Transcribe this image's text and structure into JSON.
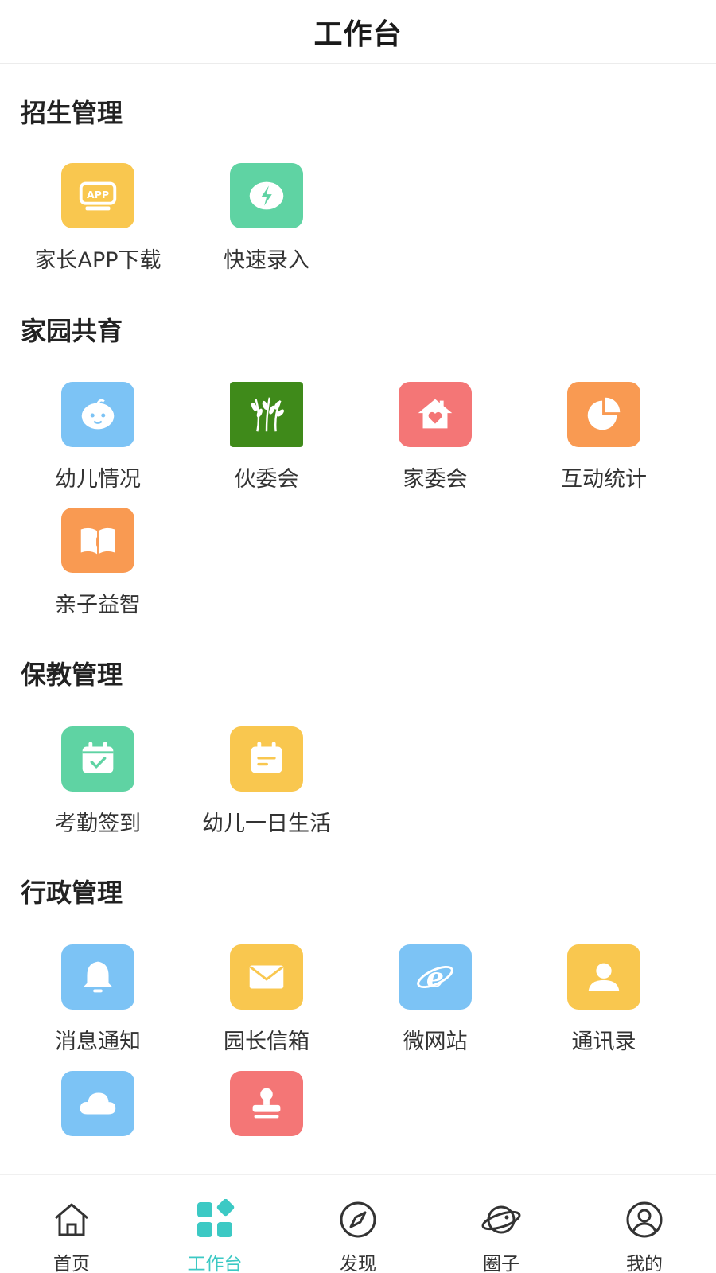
{
  "header": {
    "title": "工作台"
  },
  "sections": [
    {
      "title": "招生管理",
      "items": [
        {
          "label": "家长APP下载",
          "icon": "app-download-icon",
          "color": "#f9c74f"
        },
        {
          "label": "快速录入",
          "icon": "lightning-icon",
          "color": "#5fd3a3"
        }
      ]
    },
    {
      "title": "家园共育",
      "items": [
        {
          "label": "幼儿情况",
          "icon": "baby-face-icon",
          "color": "#7cc3f5"
        },
        {
          "label": "伙委会",
          "icon": "wheat-icon",
          "color": "#3f8a1a"
        },
        {
          "label": "家委会",
          "icon": "house-heart-icon",
          "color": "#f47676"
        },
        {
          "label": "互动统计",
          "icon": "pie-chart-icon",
          "color": "#f99a52"
        },
        {
          "label": "亲子益智",
          "icon": "book-icon",
          "color": "#f99a52"
        }
      ]
    },
    {
      "title": "保教管理",
      "items": [
        {
          "label": "考勤签到",
          "icon": "calendar-check-icon",
          "color": "#5fd3a3"
        },
        {
          "label": "幼儿一日生活",
          "icon": "calendar-note-icon",
          "color": "#f9c74f"
        }
      ]
    },
    {
      "title": "行政管理",
      "items": [
        {
          "label": "消息通知",
          "icon": "bell-icon",
          "color": "#7cc3f5"
        },
        {
          "label": "园长信箱",
          "icon": "envelope-icon",
          "color": "#f9c74f"
        },
        {
          "label": "微网站",
          "icon": "browser-e-icon",
          "color": "#7cc3f5"
        },
        {
          "label": "通讯录",
          "icon": "contact-icon",
          "color": "#f9c74f"
        },
        {
          "label": "",
          "icon": "cloud-icon",
          "color": "#7cc3f5"
        },
        {
          "label": "",
          "icon": "stamp-icon",
          "color": "#f47676"
        }
      ]
    }
  ],
  "tabbar": {
    "items": [
      {
        "label": "首页",
        "icon": "home-icon"
      },
      {
        "label": "工作台",
        "icon": "workbench-icon",
        "active": true
      },
      {
        "label": "发现",
        "icon": "compass-icon"
      },
      {
        "label": "圈子",
        "icon": "planet-icon"
      },
      {
        "label": "我的",
        "icon": "user-icon"
      }
    ],
    "active_color": "#3cc9c4"
  }
}
